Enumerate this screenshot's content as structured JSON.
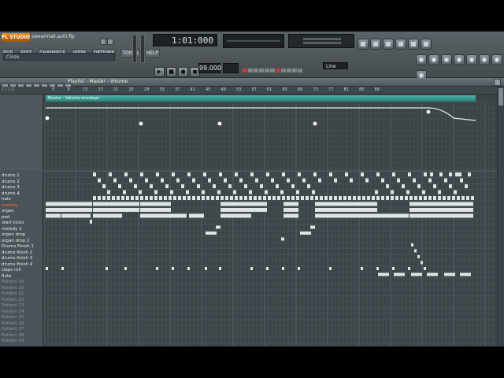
{
  "app": {
    "logo_text": "FL STUDIO",
    "song_file": "swearmall.avi0.flp",
    "hint": "Close",
    "time": "1:01:000",
    "bpm": "99.000",
    "line_mode": "Line"
  },
  "menu": [
    "FILE",
    "EDIT",
    "CHANNELS",
    "VIEW",
    "OPTIONS",
    "TOOLS",
    "HELP"
  ],
  "transport": [
    "▶",
    "■",
    "●",
    "◼"
  ],
  "toolbar_icons_row1": [
    "piano-roll-icon",
    "channels-icon",
    "mixer-icon",
    "playlist-icon",
    "browser-icon",
    "plugin-icon"
  ],
  "toolbar_icons_row2": [
    "tempo-icon",
    "record-icon",
    "snap-icon",
    "link-icon",
    "download-icon",
    "help-icon",
    "zoom-icon",
    "settings-icon"
  ],
  "playlist": {
    "title": "Playlist - Master - Volume",
    "envelope_label": "Master - Volume envelope",
    "ruler_left": "1  |  1:1",
    "ruler": [
      "5",
      "9",
      "13",
      "17",
      "21",
      "25",
      "29",
      "33",
      "37",
      "41",
      "45",
      "49",
      "53",
      "57",
      "61",
      "65",
      "69",
      "73",
      "77",
      "81",
      "85",
      "89"
    ],
    "tracks": [
      {
        "name": "drums 1",
        "state": "normal"
      },
      {
        "name": "drums 2",
        "state": "normal"
      },
      {
        "name": "drums 3",
        "state": "normal"
      },
      {
        "name": "drums 4",
        "state": "normal"
      },
      {
        "name": "hats",
        "state": "normal"
      },
      {
        "name": "melody",
        "state": "selected"
      },
      {
        "name": "organ",
        "state": "normal"
      },
      {
        "name": "pad",
        "state": "normal"
      },
      {
        "name": "start kicks",
        "state": "normal"
      },
      {
        "name": "melody 2",
        "state": "normal"
      },
      {
        "name": "organ drop",
        "state": "normal"
      },
      {
        "name": "organ drop 2",
        "state": "normal"
      },
      {
        "name": "Drums Finish 1",
        "state": "normal"
      },
      {
        "name": "drums finish 2",
        "state": "normal"
      },
      {
        "name": "drums finish 3",
        "state": "normal"
      },
      {
        "name": "drums finish 4",
        "state": "normal"
      },
      {
        "name": "claps roll",
        "state": "normal"
      },
      {
        "name": "flute",
        "state": "normal"
      },
      {
        "name": "Pattern 19",
        "state": "dim"
      },
      {
        "name": "Pattern 20",
        "state": "dim"
      },
      {
        "name": "Pattern 21",
        "state": "dim"
      },
      {
        "name": "Pattern 22",
        "state": "dim"
      },
      {
        "name": "Pattern 23",
        "state": "dim"
      },
      {
        "name": "Pattern 24",
        "state": "dim"
      },
      {
        "name": "Pattern 25",
        "state": "dim"
      },
      {
        "name": "Pattern 26",
        "state": "dim"
      },
      {
        "name": "Pattern 27",
        "state": "dim"
      },
      {
        "name": "Pattern 28",
        "state": "dim"
      },
      {
        "name": "Pattern 29",
        "state": "dim"
      }
    ]
  },
  "colors": {
    "accent_teal": "#3a9f96",
    "selected_track": "#ff6a3a",
    "block": "#dfe4e6"
  }
}
